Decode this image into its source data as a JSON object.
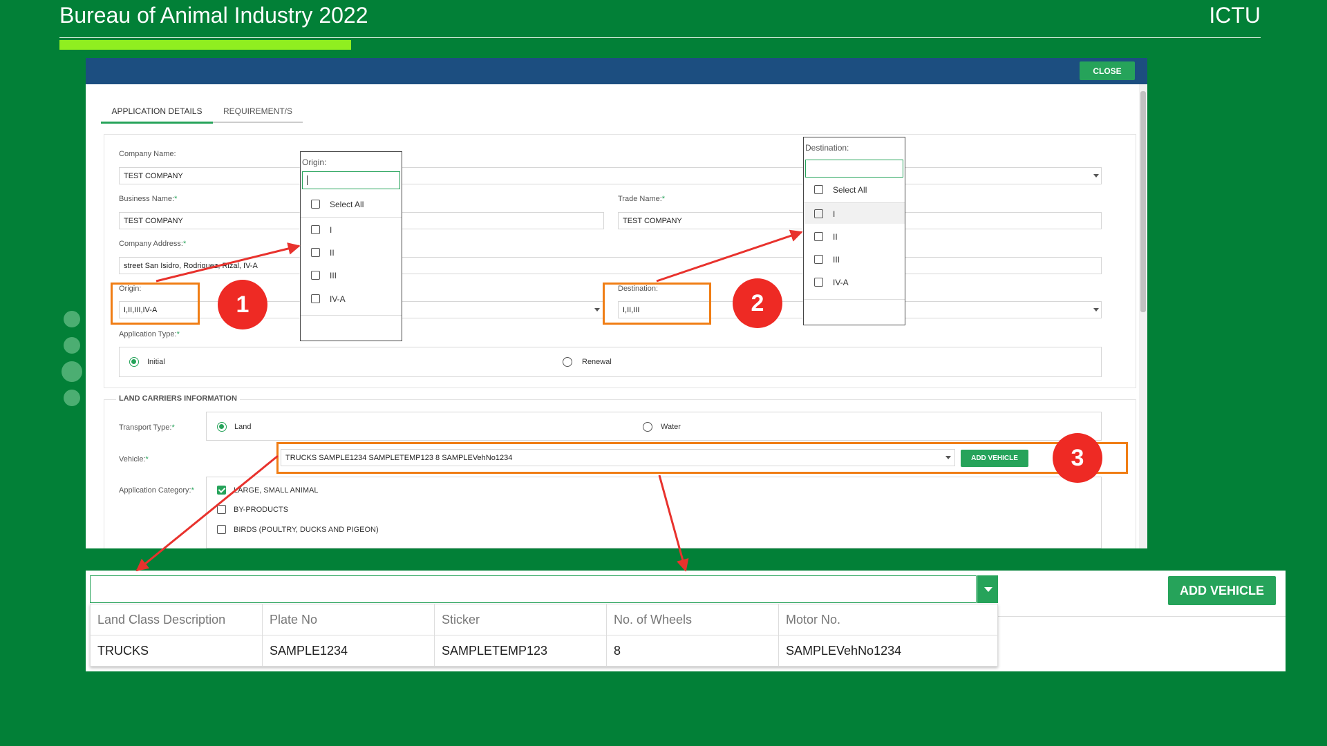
{
  "slide": {
    "title": "Bureau of Animal Industry 2022",
    "org": "ICTU"
  },
  "colors": {
    "background": "#028037",
    "accent": "#90ee20",
    "header": "#1c4e80",
    "button": "#26a35a",
    "highlight": "#f07d14",
    "badge": "#ee2a24"
  },
  "app": {
    "close_label": "CLOSE",
    "tabs": [
      {
        "label": "APPLICATION DETAILS"
      },
      {
        "label": "REQUIREMENT/S"
      }
    ],
    "company_name": {
      "label": "Company Name:",
      "value": "TEST COMPANY"
    },
    "business_name": {
      "label": "Business Name:",
      "value": "TEST COMPANY"
    },
    "trade_name": {
      "label": "Trade Name:",
      "value": "TEST COMPANY"
    },
    "company_address": {
      "label": "Company Address:",
      "value": "street San Isidro, Rodriguez, Rizal, IV-A"
    },
    "origin": {
      "label": "Origin:",
      "value": "I,II,III,IV-A"
    },
    "destination": {
      "label": "Destination:",
      "value": "I,II,III"
    },
    "application_type": {
      "label": "Application Type:",
      "options": [
        "Initial",
        "Renewal"
      ],
      "selected": "Initial"
    },
    "land_carriers": {
      "title": "LAND CARRIERS INFORMATION",
      "transport_type": {
        "label": "Transport Type:",
        "options": [
          "Land",
          "Water"
        ],
        "selected": "Land"
      },
      "vehicle": {
        "label": "Vehicle:",
        "value": "TRUCKS SAMPLE1234 SAMPLETEMP123 8 SAMPLEVehNo1234",
        "add_label": "ADD VEHICLE"
      },
      "category": {
        "label": "Application Category:",
        "options": [
          "LARGE, SMALL ANIMAL",
          "BY-PRODUCTS",
          "BIRDS (POULTRY, DUCKS AND PIGEON)"
        ],
        "checked": [
          "LARGE, SMALL ANIMAL"
        ]
      }
    }
  },
  "origin_dropdown": {
    "title": "Origin:",
    "select_all": "Select All",
    "options": [
      "I",
      "II",
      "III",
      "IV-A"
    ]
  },
  "destination_dropdown": {
    "title": "Destination:",
    "select_all": "Select All",
    "options": [
      "I",
      "II",
      "III",
      "IV-A"
    ]
  },
  "badges": [
    "1",
    "2",
    "3"
  ],
  "zoom": {
    "add_label": "ADD VEHICLE",
    "columns": [
      "Land Class Description",
      "Plate No",
      "Sticker",
      "No. of Wheels",
      "Motor No."
    ],
    "rows": [
      [
        "TRUCKS",
        "SAMPLE1234",
        "SAMPLETEMP123",
        "8",
        "SAMPLEVehNo1234"
      ]
    ]
  },
  "icons": [
    "chevron-down-icon",
    "checkbox-icon",
    "radio-icon",
    "arrow-annotation"
  ]
}
